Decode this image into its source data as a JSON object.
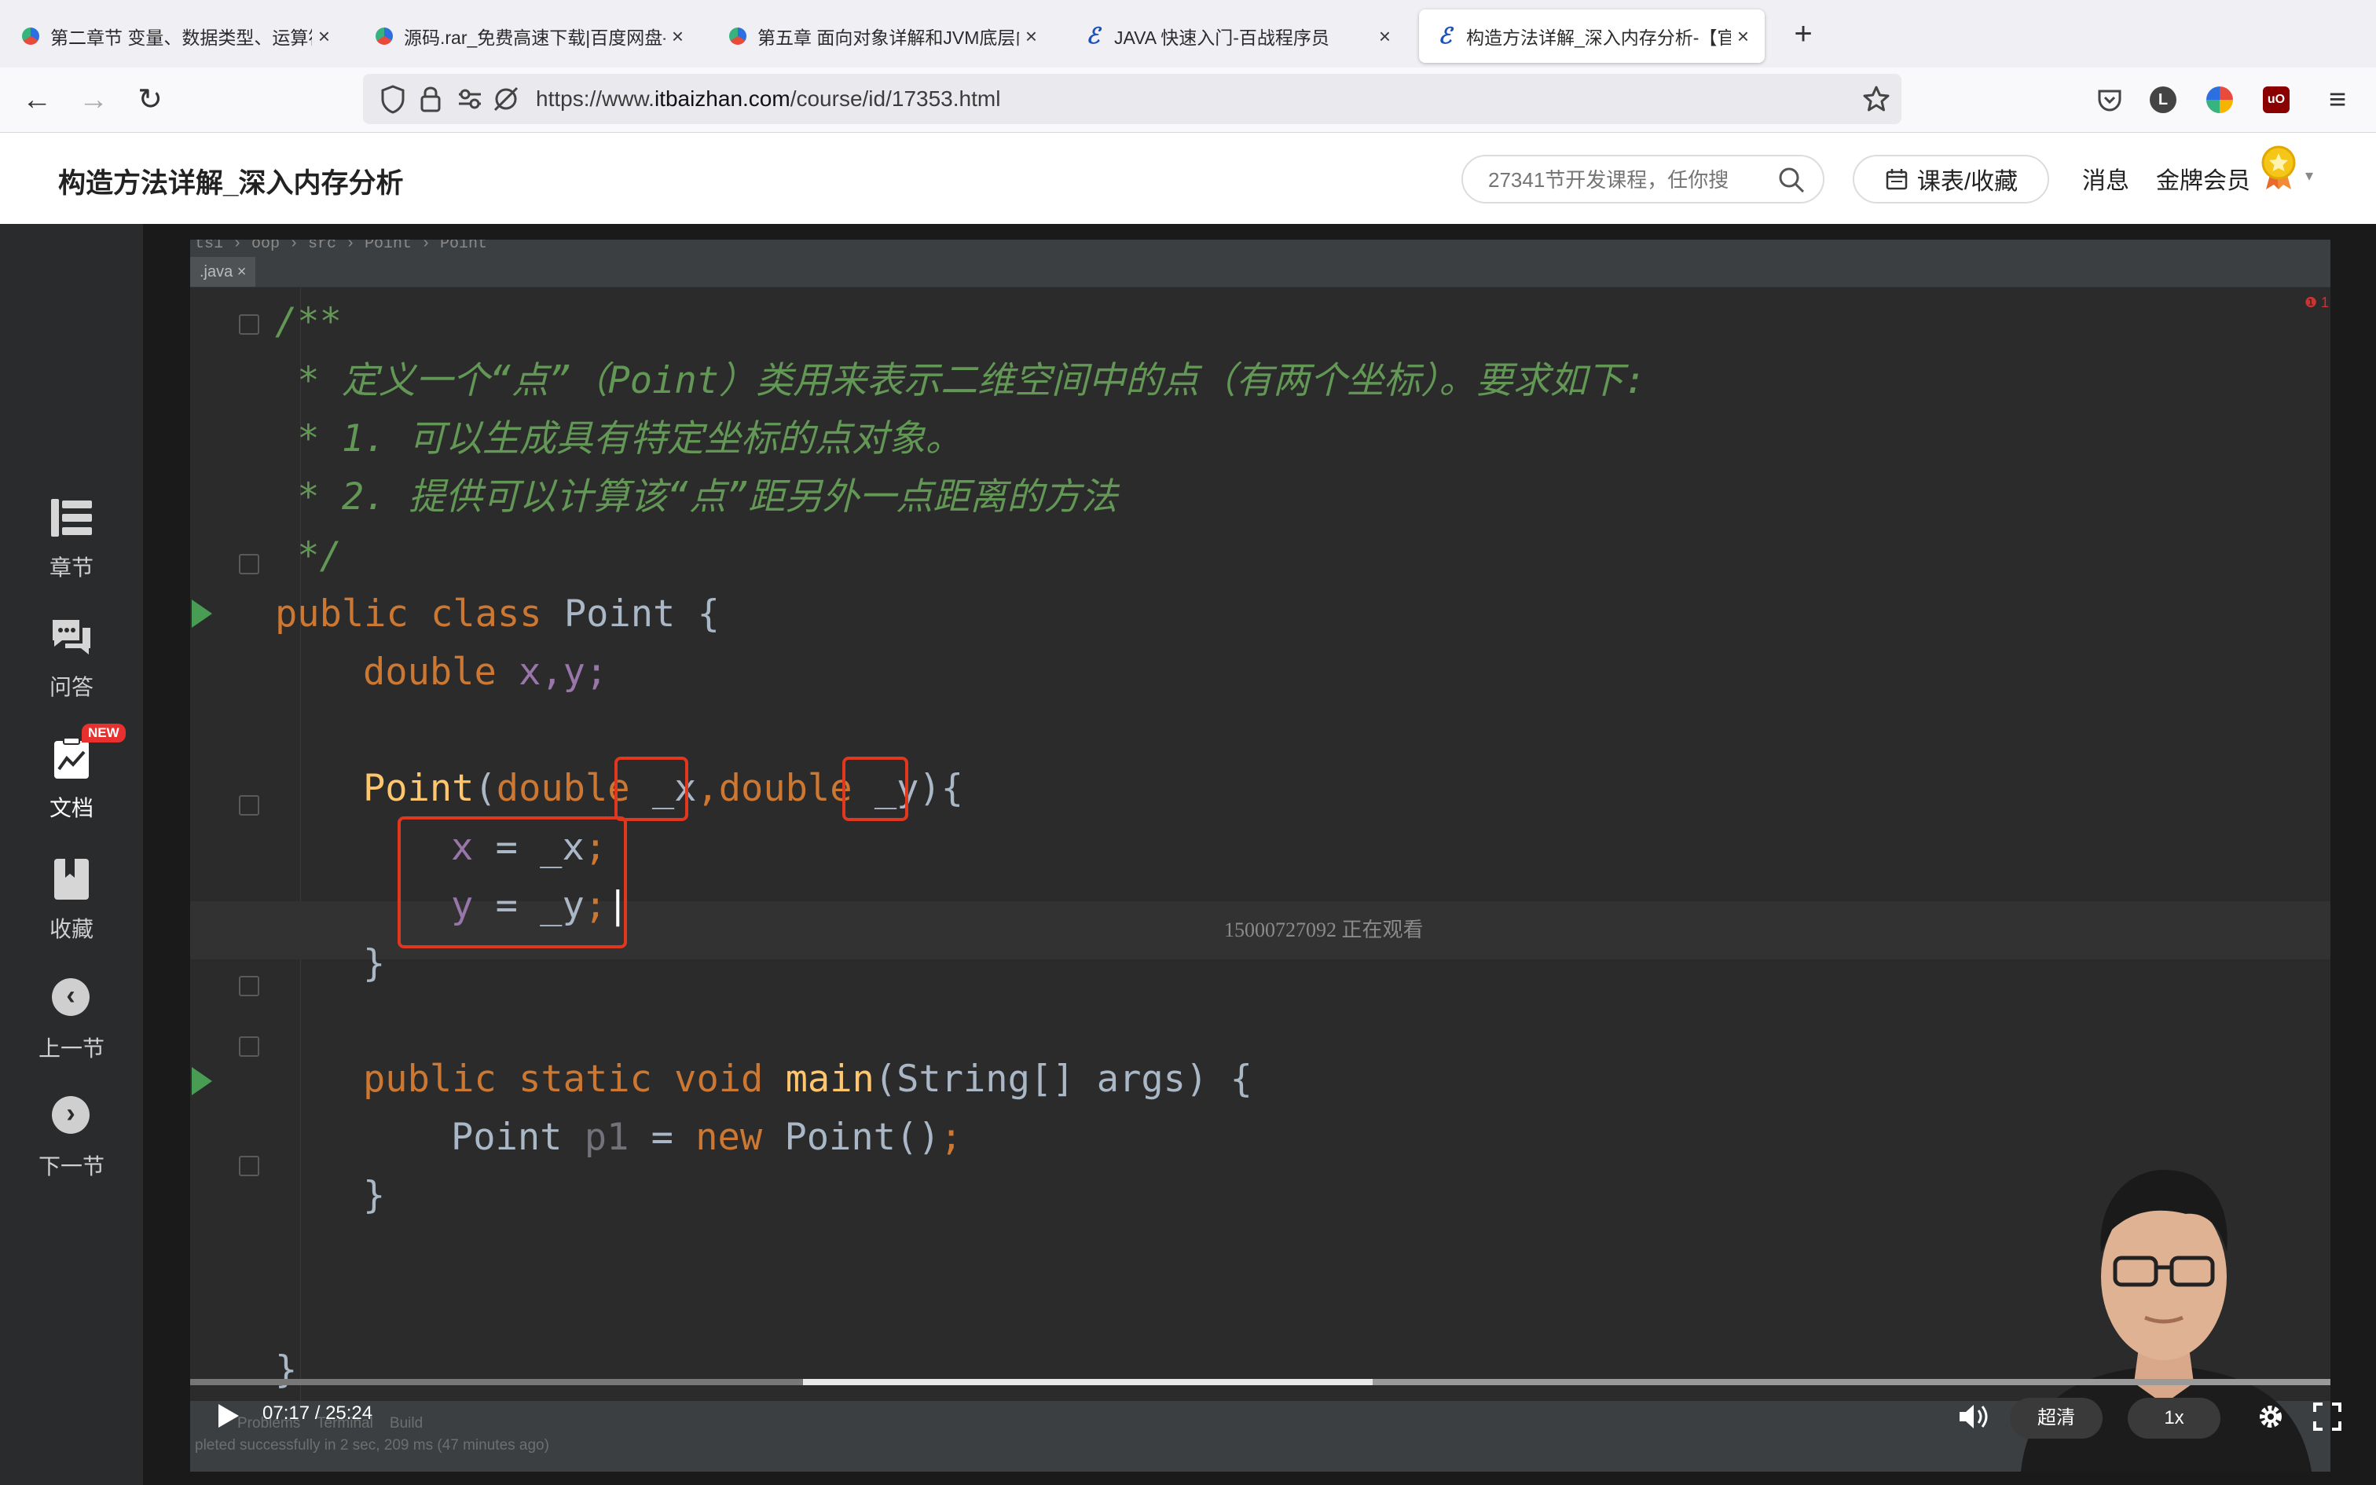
{
  "browser": {
    "tabs": [
      {
        "label": "第二章节 变量、数据类型、运算符",
        "icon": "baidu-icon"
      },
      {
        "label": "源码.rar_免费高速下载|百度网盘-分",
        "icon": "baidu-icon"
      },
      {
        "label": "第五章 面向对象详解和JVM底层内",
        "icon": "baidu-icon"
      },
      {
        "label": "JAVA 快速入门-百战程序员",
        "icon": "itbaizhan-icon"
      },
      {
        "label": "构造方法详解_深入内存分析-【官",
        "icon": "itbaizhan-icon"
      }
    ],
    "close_glyph": "×",
    "new_tab_glyph": "+",
    "url_prefix": "https://www.",
    "url_domain": "itbaizhan.com",
    "url_path": "/course/id/17353.html",
    "extension_letter": "L"
  },
  "header": {
    "title": "构造方法详解_深入内存分析",
    "search_placeholder": "27341节开发课程，任你搜",
    "schedule_label": "课表/收藏",
    "messages_label": "消息",
    "member_label": "金牌会员"
  },
  "sidebar": {
    "items": [
      {
        "label": "章节",
        "icon": "chapter-list-icon"
      },
      {
        "label": "问答",
        "icon": "qa-chat-icon"
      },
      {
        "label": "文档",
        "icon": "document-chart-icon",
        "badge": "NEW"
      },
      {
        "label": "收藏",
        "icon": "bookmark-icon"
      },
      {
        "label": "上一节",
        "icon": "chevron-left-icon",
        "glyph": "‹"
      },
      {
        "label": "下一节",
        "icon": "chevron-right-icon",
        "glyph": "›"
      }
    ]
  },
  "ide": {
    "breadcrumb": "ts1 › oop › src › Point › Point",
    "file_tab": ".java ×",
    "watermark": "15000727092 正在观看",
    "error_marker": "❶ 1",
    "status": "pleted successfully in 2 sec, 209 ms (47 minutes ago)",
    "bottom_tabs": "Problems    Terminal    Build",
    "code": {
      "l1": "/**",
      "l2": " * 定义一个“点”（Point）类用来表示二维空间中的点（有两个坐标）。要求如下:",
      "l3": " * 1. 可以生成具有特定坐标的点对象。",
      "l4": " * 2. 提供可以计算该“点”距另外一点距离的方法",
      "l5": " */",
      "l6_kw": "public class ",
      "l6_name": "Point {",
      "l7_kw": "double ",
      "l7_fields": "x,y;",
      "l9_fn": "Point",
      "l9_open": "(",
      "l9_kw1": "double ",
      "l9_p1": "_x",
      "l9_comma": ",",
      "l9_kw2": "double ",
      "l9_p2": "_y",
      "l9_close": "){",
      "l10_field": "x",
      "l10_rest": " = _x",
      "l10_semi": ";",
      "l11_field": "y",
      "l11_rest": " = _y",
      "l11_semi": ";",
      "l12": "}",
      "l14_kw": "public static void ",
      "l14_fn": "main",
      "l14_rest": "(String[] args) {",
      "l15_type": "Point ",
      "l15_var": "p1",
      "l15_eq": " = ",
      "l15_kw": "new ",
      "l15_call": "Point()",
      "l15_semi": ";",
      "l16": "}",
      "l18": "}"
    }
  },
  "player": {
    "time": "07:17 / 25:24",
    "quality": "超清",
    "speed": "1x",
    "progress": 0.287,
    "buffered": 0.79
  },
  "colors": {
    "accent_red": "#e0371f",
    "comment_green": "#629755",
    "keyword_orange": "#cc7832",
    "field_purple": "#9876aa",
    "method_yellow": "#ffc66d"
  }
}
